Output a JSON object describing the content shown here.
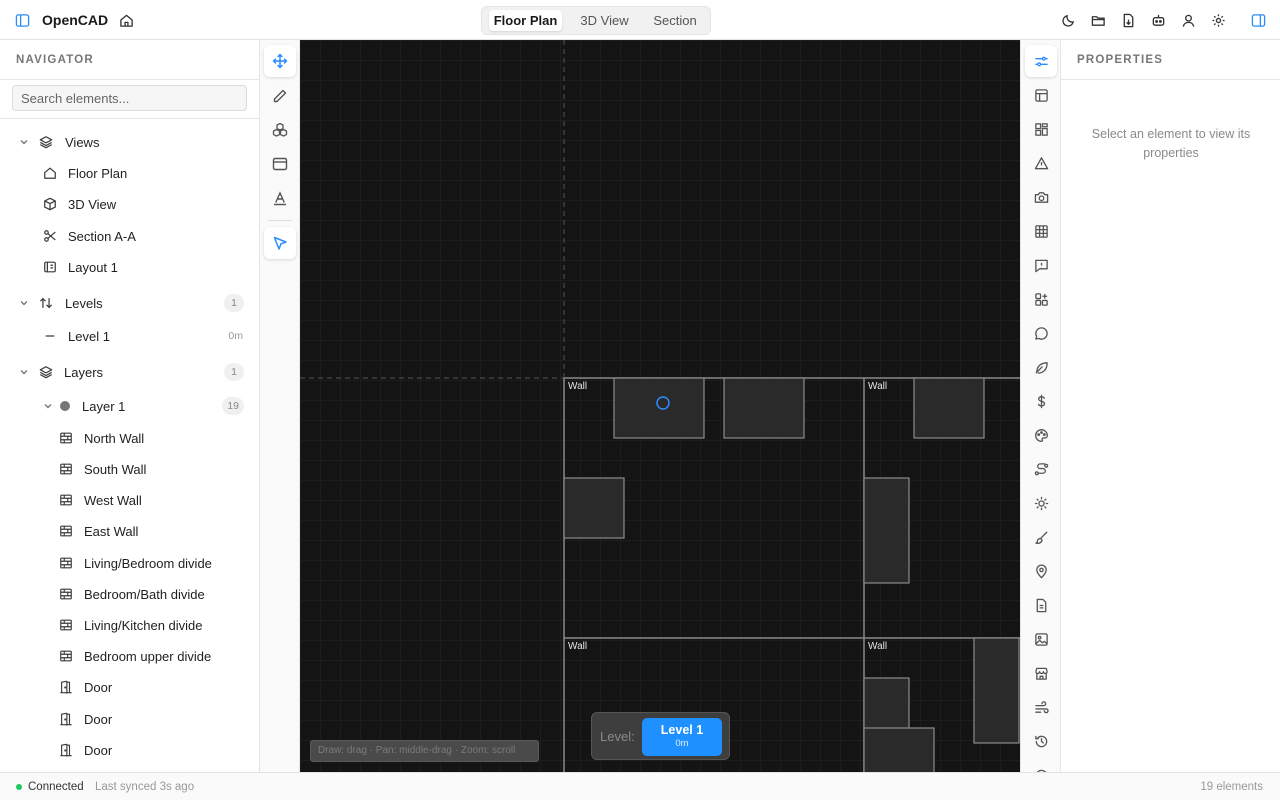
{
  "app": {
    "title": "OpenCAD"
  },
  "view_tabs": [
    {
      "label": "Floor Plan",
      "active": true
    },
    {
      "label": "3D View",
      "active": false
    },
    {
      "label": "Section",
      "active": false
    }
  ],
  "navigator": {
    "title": "NAVIGATOR",
    "search_placeholder": "Search elements...",
    "views": {
      "label": "Views",
      "items": [
        "Floor Plan",
        "3D View",
        "Section A-A",
        "Layout 1"
      ]
    },
    "levels": {
      "label": "Levels",
      "count": "1",
      "items": [
        {
          "label": "Level 1",
          "meta": "0m"
        }
      ]
    },
    "layers": {
      "label": "Layers",
      "count": "1",
      "layer": {
        "label": "Layer 1",
        "count": "19"
      },
      "elements": [
        {
          "label": "North Wall",
          "icon": "wall-icon"
        },
        {
          "label": "South Wall",
          "icon": "wall-icon"
        },
        {
          "label": "West Wall",
          "icon": "wall-icon"
        },
        {
          "label": "East Wall",
          "icon": "wall-icon"
        },
        {
          "label": "Living/Bedroom divide",
          "icon": "wall-icon"
        },
        {
          "label": "Bedroom/Bath divide",
          "icon": "wall-icon"
        },
        {
          "label": "Living/Kitchen divide",
          "icon": "wall-icon"
        },
        {
          "label": "Bedroom upper divide",
          "icon": "wall-icon"
        },
        {
          "label": "Door",
          "icon": "door-icon"
        },
        {
          "label": "Door",
          "icon": "door-icon"
        },
        {
          "label": "Door",
          "icon": "door-icon"
        }
      ]
    }
  },
  "canvas": {
    "wall_labels": [
      "Wall",
      "Wall",
      "Wall",
      "Wall"
    ],
    "hint": "Draw: drag · Pan: middle-drag · Zoom: scroll",
    "level_caption": "Level:",
    "level_name": "Level 1",
    "level_elevation": "0m"
  },
  "properties": {
    "title": "PROPERTIES",
    "empty_text": "Select an element to view its properties"
  },
  "status": {
    "connection": "Connected",
    "sync": "Last synced 3s ago",
    "element_count": "19 elements"
  },
  "colors": {
    "accent": "#1e90ff",
    "connected": "#22c55e",
    "canvas_bg": "#141414"
  }
}
